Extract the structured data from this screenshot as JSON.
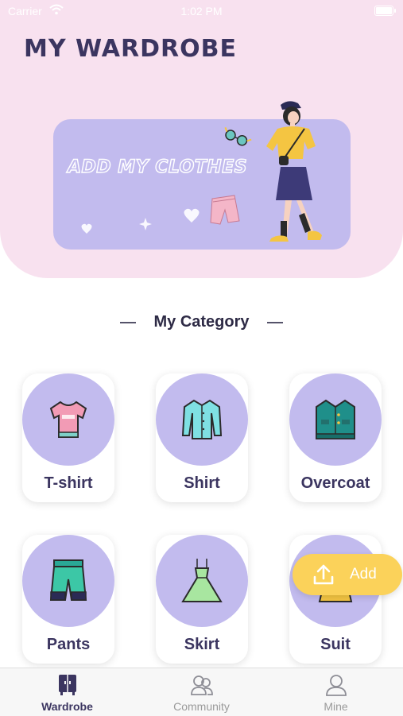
{
  "status_bar": {
    "carrier": "Carrier",
    "time": "1:02 PM"
  },
  "header": {
    "title": "MY WARDROBE"
  },
  "banner": {
    "text": "ADD MY CLOTHES"
  },
  "category_section": {
    "title": "My Category"
  },
  "categories": [
    {
      "label": "T-shirt",
      "icon": "tshirt-icon"
    },
    {
      "label": "Shirt",
      "icon": "shirt-icon"
    },
    {
      "label": "Overcoat",
      "icon": "overcoat-icon"
    },
    {
      "label": "Pants",
      "icon": "pants-icon"
    },
    {
      "label": "Skirt",
      "icon": "skirt-icon"
    },
    {
      "label": "Suit",
      "icon": "suit-icon"
    }
  ],
  "fab": {
    "label": "Add",
    "icon": "upload-icon"
  },
  "tabs": [
    {
      "label": "Wardrobe",
      "icon": "wardrobe-icon",
      "active": true
    },
    {
      "label": "Community",
      "icon": "community-icon",
      "active": false
    },
    {
      "label": "Mine",
      "icon": "user-icon",
      "active": false
    }
  ],
  "colors": {
    "header_bg": "#f8e1ef",
    "accent_lavender": "#c2bbee",
    "title_navy": "#3b3560",
    "fab_yellow": "#fbd25a"
  }
}
